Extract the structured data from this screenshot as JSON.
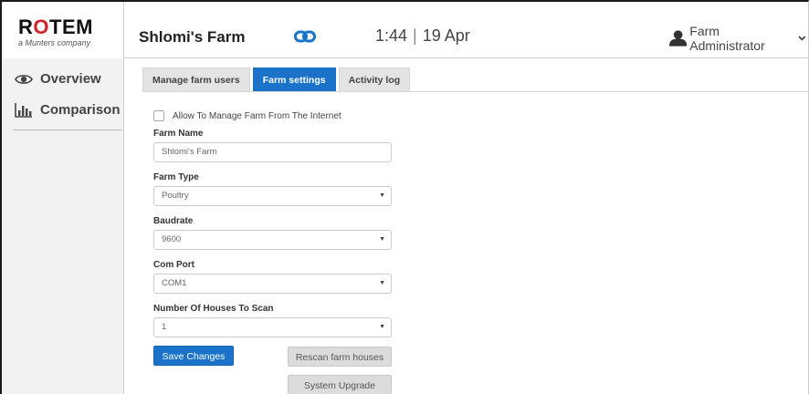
{
  "header": {
    "logo_text_a": "R",
    "logo_text_o": "O",
    "logo_text_b": "TEM",
    "logo_sub": "a Munters company",
    "farm_name": "Shlomi's Farm",
    "time": "1:44",
    "date": "19 Apr",
    "user": "Farm Administrator"
  },
  "sidebar": {
    "items": [
      {
        "label": "Overview",
        "icon": "eye-icon"
      },
      {
        "label": "Comparison",
        "icon": "bar-chart-icon"
      }
    ]
  },
  "tabs": [
    {
      "label": "Manage farm users",
      "active": false
    },
    {
      "label": "Farm settings",
      "active": true
    },
    {
      "label": "Activity log",
      "active": false
    }
  ],
  "form": {
    "allow_internet_label": "Allow To Manage Farm From The Internet",
    "allow_internet_checked": false,
    "farm_name_label": "Farm Name",
    "farm_name_value": "Shlomi's Farm",
    "farm_type_label": "Farm Type",
    "farm_type_value": "Poultry",
    "baudrate_label": "Baudrate",
    "baudrate_value": "9600",
    "com_port_label": "Com Port",
    "com_port_value": "COM1",
    "houses_label": "Number Of Houses To Scan",
    "houses_value": "1",
    "caret": "▼"
  },
  "buttons": {
    "save": "Save Changes",
    "rescan": "Rescan farm houses",
    "upgrade": "System Upgrade"
  },
  "colors": {
    "accent": "#1a73c9",
    "logo_red": "#d2232a"
  }
}
